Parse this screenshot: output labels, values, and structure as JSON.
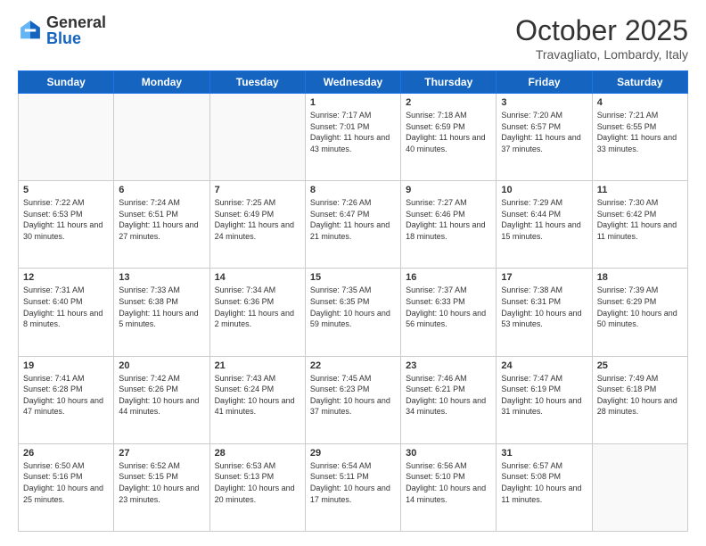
{
  "header": {
    "logo_general": "General",
    "logo_blue": "Blue",
    "month_title": "October 2025",
    "location": "Travagliato, Lombardy, Italy"
  },
  "days_of_week": [
    "Sunday",
    "Monday",
    "Tuesday",
    "Wednesday",
    "Thursday",
    "Friday",
    "Saturday"
  ],
  "weeks": [
    [
      {
        "day": "",
        "info": ""
      },
      {
        "day": "",
        "info": ""
      },
      {
        "day": "",
        "info": ""
      },
      {
        "day": "1",
        "info": "Sunrise: 7:17 AM\nSunset: 7:01 PM\nDaylight: 11 hours and 43 minutes."
      },
      {
        "day": "2",
        "info": "Sunrise: 7:18 AM\nSunset: 6:59 PM\nDaylight: 11 hours and 40 minutes."
      },
      {
        "day": "3",
        "info": "Sunrise: 7:20 AM\nSunset: 6:57 PM\nDaylight: 11 hours and 37 minutes."
      },
      {
        "day": "4",
        "info": "Sunrise: 7:21 AM\nSunset: 6:55 PM\nDaylight: 11 hours and 33 minutes."
      }
    ],
    [
      {
        "day": "5",
        "info": "Sunrise: 7:22 AM\nSunset: 6:53 PM\nDaylight: 11 hours and 30 minutes."
      },
      {
        "day": "6",
        "info": "Sunrise: 7:24 AM\nSunset: 6:51 PM\nDaylight: 11 hours and 27 minutes."
      },
      {
        "day": "7",
        "info": "Sunrise: 7:25 AM\nSunset: 6:49 PM\nDaylight: 11 hours and 24 minutes."
      },
      {
        "day": "8",
        "info": "Sunrise: 7:26 AM\nSunset: 6:47 PM\nDaylight: 11 hours and 21 minutes."
      },
      {
        "day": "9",
        "info": "Sunrise: 7:27 AM\nSunset: 6:46 PM\nDaylight: 11 hours and 18 minutes."
      },
      {
        "day": "10",
        "info": "Sunrise: 7:29 AM\nSunset: 6:44 PM\nDaylight: 11 hours and 15 minutes."
      },
      {
        "day": "11",
        "info": "Sunrise: 7:30 AM\nSunset: 6:42 PM\nDaylight: 11 hours and 11 minutes."
      }
    ],
    [
      {
        "day": "12",
        "info": "Sunrise: 7:31 AM\nSunset: 6:40 PM\nDaylight: 11 hours and 8 minutes."
      },
      {
        "day": "13",
        "info": "Sunrise: 7:33 AM\nSunset: 6:38 PM\nDaylight: 11 hours and 5 minutes."
      },
      {
        "day": "14",
        "info": "Sunrise: 7:34 AM\nSunset: 6:36 PM\nDaylight: 11 hours and 2 minutes."
      },
      {
        "day": "15",
        "info": "Sunrise: 7:35 AM\nSunset: 6:35 PM\nDaylight: 10 hours and 59 minutes."
      },
      {
        "day": "16",
        "info": "Sunrise: 7:37 AM\nSunset: 6:33 PM\nDaylight: 10 hours and 56 minutes."
      },
      {
        "day": "17",
        "info": "Sunrise: 7:38 AM\nSunset: 6:31 PM\nDaylight: 10 hours and 53 minutes."
      },
      {
        "day": "18",
        "info": "Sunrise: 7:39 AM\nSunset: 6:29 PM\nDaylight: 10 hours and 50 minutes."
      }
    ],
    [
      {
        "day": "19",
        "info": "Sunrise: 7:41 AM\nSunset: 6:28 PM\nDaylight: 10 hours and 47 minutes."
      },
      {
        "day": "20",
        "info": "Sunrise: 7:42 AM\nSunset: 6:26 PM\nDaylight: 10 hours and 44 minutes."
      },
      {
        "day": "21",
        "info": "Sunrise: 7:43 AM\nSunset: 6:24 PM\nDaylight: 10 hours and 41 minutes."
      },
      {
        "day": "22",
        "info": "Sunrise: 7:45 AM\nSunset: 6:23 PM\nDaylight: 10 hours and 37 minutes."
      },
      {
        "day": "23",
        "info": "Sunrise: 7:46 AM\nSunset: 6:21 PM\nDaylight: 10 hours and 34 minutes."
      },
      {
        "day": "24",
        "info": "Sunrise: 7:47 AM\nSunset: 6:19 PM\nDaylight: 10 hours and 31 minutes."
      },
      {
        "day": "25",
        "info": "Sunrise: 7:49 AM\nSunset: 6:18 PM\nDaylight: 10 hours and 28 minutes."
      }
    ],
    [
      {
        "day": "26",
        "info": "Sunrise: 6:50 AM\nSunset: 5:16 PM\nDaylight: 10 hours and 25 minutes."
      },
      {
        "day": "27",
        "info": "Sunrise: 6:52 AM\nSunset: 5:15 PM\nDaylight: 10 hours and 23 minutes."
      },
      {
        "day": "28",
        "info": "Sunrise: 6:53 AM\nSunset: 5:13 PM\nDaylight: 10 hours and 20 minutes."
      },
      {
        "day": "29",
        "info": "Sunrise: 6:54 AM\nSunset: 5:11 PM\nDaylight: 10 hours and 17 minutes."
      },
      {
        "day": "30",
        "info": "Sunrise: 6:56 AM\nSunset: 5:10 PM\nDaylight: 10 hours and 14 minutes."
      },
      {
        "day": "31",
        "info": "Sunrise: 6:57 AM\nSunset: 5:08 PM\nDaylight: 10 hours and 11 minutes."
      },
      {
        "day": "",
        "info": ""
      }
    ]
  ]
}
